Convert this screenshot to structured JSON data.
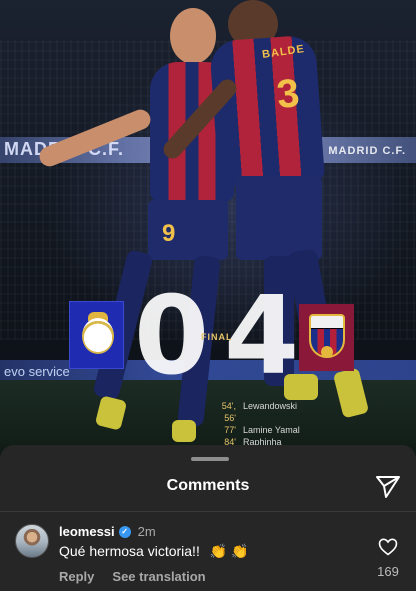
{
  "story": {
    "ad_left": "MADRID C.F.",
    "ad_right": "MADRID C.F.",
    "ad_low": "evo service",
    "player_back_name": "BALDE",
    "player_back_number": "3",
    "player_front_number": "9",
    "score_home": "0",
    "score_away": "4",
    "final_label": "FINAL",
    "scorers": [
      {
        "minute": "54', 56'",
        "name": "Lewandowski"
      },
      {
        "minute": "77'",
        "name": "Lamine Yamal"
      },
      {
        "minute": "84'",
        "name": "Raphinha"
      }
    ]
  },
  "sheet": {
    "title": "Comments",
    "share_icon": "paper-plane-icon"
  },
  "comment": {
    "username": "leomessi",
    "time": "2m",
    "text": "Qué hermosa victoria!!",
    "emoji": "👏 👏",
    "reply_label": "Reply",
    "translate_label": "See translation",
    "like_count": "169"
  },
  "colors": {
    "sheet_bg": "#262626",
    "verified": "#3897f0",
    "rm_blue": "#1f2bb0",
    "fcb_maroon": "#8a1838",
    "gold": "#e6c46a"
  }
}
